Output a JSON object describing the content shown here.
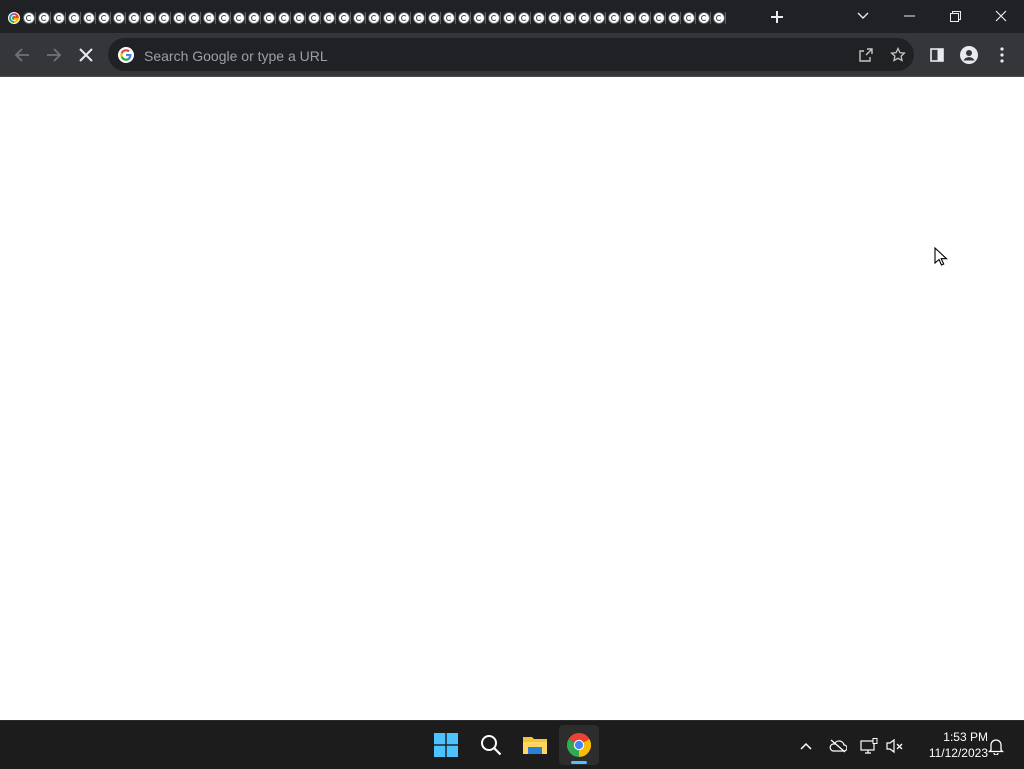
{
  "browser": {
    "tab_count": 48,
    "active_tab_index": 0,
    "tab_favicon": "chrome-favicon",
    "omnibox": {
      "placeholder": "Search Google or type a URL",
      "value": ""
    },
    "icons": {
      "back": "back-arrow-icon",
      "forward": "forward-arrow-icon",
      "stop": "stop-loading-icon",
      "share": "share-icon",
      "bookmark": "star-icon",
      "side_panel": "side-panel-icon",
      "profile": "profile-icon",
      "menu": "kebab-menu-icon",
      "new_tab": "plus-icon",
      "tab_search": "chevron-down-icon",
      "minimize": "minimize-icon",
      "restore": "restore-icon",
      "close": "close-icon"
    },
    "colors": {
      "frame": "#202124",
      "toolbar": "#35363a",
      "omnibox": "#202124",
      "text": "#e8eaed",
      "placeholder": "#9aa0a6"
    }
  },
  "taskbar": {
    "apps": [
      {
        "name": "Start",
        "icon": "windows-logo-icon",
        "active": false
      },
      {
        "name": "Search",
        "icon": "search-icon",
        "active": false
      },
      {
        "name": "File Explorer",
        "icon": "folder-icon",
        "active": false
      },
      {
        "name": "Google Chrome",
        "icon": "chrome-icon",
        "active": true
      }
    ],
    "tray_icons": [
      "chevron-up-icon",
      "onedrive-offline-icon",
      "network-icon",
      "volume-muted-icon",
      "notification-bell-icon"
    ],
    "time": "1:53 PM",
    "date": "11/12/2023",
    "accent": "#4cc2ff"
  }
}
